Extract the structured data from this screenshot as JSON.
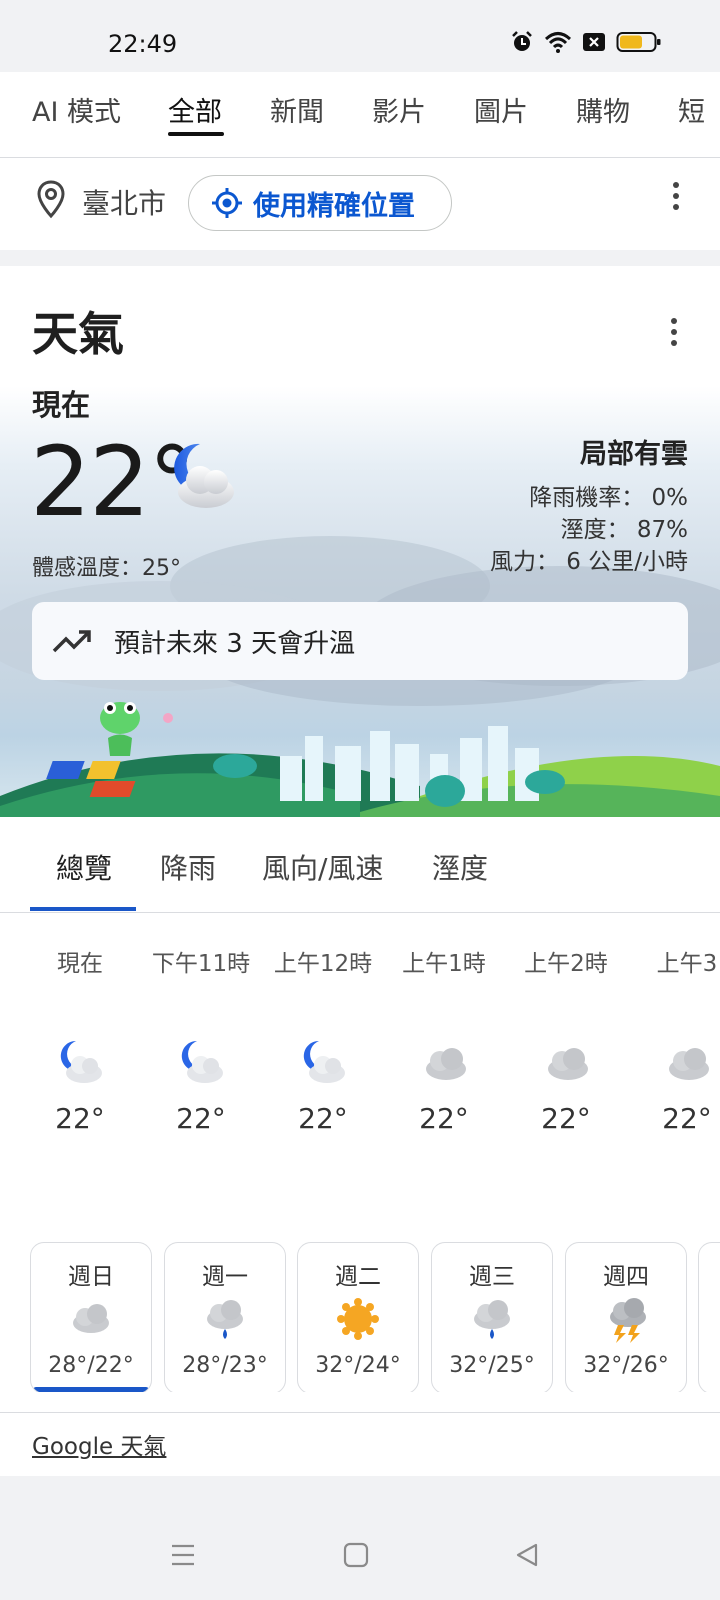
{
  "status_bar": {
    "time": "22:49"
  },
  "search_tabs": [
    {
      "label": "AI 模式"
    },
    {
      "label": "全部"
    },
    {
      "label": "新聞"
    },
    {
      "label": "影片"
    },
    {
      "label": "圖片"
    },
    {
      "label": "購物"
    },
    {
      "label": "短"
    }
  ],
  "location": {
    "city": "臺北市",
    "precise_button": "使用精確位置"
  },
  "weather": {
    "title": "天氣",
    "now_label": "現在",
    "temperature": "22°",
    "feels_like": "體感溫度：25°",
    "condition": "局部有雲",
    "precip": "降雨機率： 0%",
    "humidity": "溼度： 87%",
    "wind": "風力： 6 公里/小時",
    "trend": "預計未來 3 天會升溫"
  },
  "sub_tabs": [
    {
      "label": "總覽"
    },
    {
      "label": "降雨"
    },
    {
      "label": "風向/風速"
    },
    {
      "label": "溼度"
    }
  ],
  "hourly": [
    {
      "label": "現在",
      "temp": "22°",
      "icon": "partly-cloudy-night-icon"
    },
    {
      "label": "下午11時",
      "temp": "22°",
      "icon": "partly-cloudy-night-icon"
    },
    {
      "label": "上午12時",
      "temp": "22°",
      "icon": "partly-cloudy-night-icon"
    },
    {
      "label": "上午1時",
      "temp": "22°",
      "icon": "cloudy-icon"
    },
    {
      "label": "上午2時",
      "temp": "22°",
      "icon": "cloudy-icon"
    },
    {
      "label": "上午3",
      "temp": "22°",
      "icon": "cloudy-icon"
    }
  ],
  "daily": [
    {
      "day": "週日",
      "temps": "28°/22°",
      "icon": "cloudy-icon"
    },
    {
      "day": "週一",
      "temps": "28°/23°",
      "icon": "rain-icon"
    },
    {
      "day": "週二",
      "temps": "32°/24°",
      "icon": "sunny-icon"
    },
    {
      "day": "週三",
      "temps": "32°/25°",
      "icon": "rain-icon"
    },
    {
      "day": "週四",
      "temps": "32°/26°",
      "icon": "thunderstorm-icon"
    }
  ],
  "source": "Google 天氣",
  "colors": {
    "accent_blue": "#0b57d0",
    "tab_indicator": "#1a57c8",
    "sun": "#f5a623"
  }
}
